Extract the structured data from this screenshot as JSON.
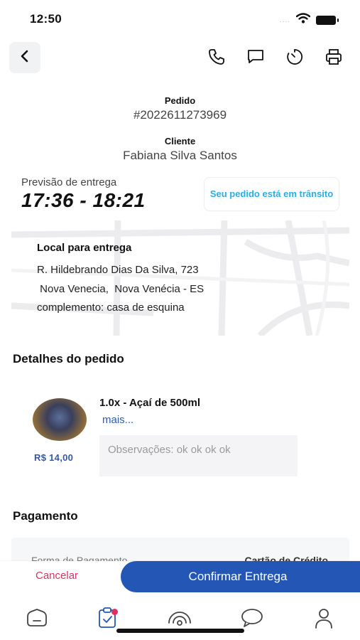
{
  "status_bar": {
    "time": "12:50",
    "signal": "....",
    "icons": [
      "wifi-icon",
      "battery-icon"
    ]
  },
  "header": {
    "back_icon": "chevron-left-icon",
    "actions": [
      "phone-icon",
      "chat-icon",
      "timer-icon",
      "printer-icon"
    ]
  },
  "order": {
    "label": "Pedido",
    "number": "#2022611273969"
  },
  "customer": {
    "label": "Cliente",
    "name": "Fabiana Silva Santos"
  },
  "forecast": {
    "label": "Previsão de entrega",
    "time": "17:36 - 18:21"
  },
  "status_badge": {
    "text": "Seu pedido está em trânsito",
    "color": "#29aee6"
  },
  "delivery": {
    "title": "Local para entrega",
    "street": "R. Hildebrando Dias Da Silva, 723",
    "city": " Nova Venecia,  Nova Venécia - ES",
    "complement": "complemento: casa de esquina"
  },
  "details": {
    "title": "Detalhes do pedido",
    "items": [
      {
        "name": "1.0x - Açaí de 500ml",
        "more": "mais...",
        "price": "R$ 14,00",
        "notes": "Observações: ok ok ok ok"
      }
    ]
  },
  "payment": {
    "title": "Pagamento",
    "method_label": "Forma de Pagamento",
    "method_value": "Cartão de Crédito"
  },
  "actions": {
    "cancel": "Cancelar",
    "confirm": "Confirmar Entrega"
  },
  "tab_bar": {
    "tabs": [
      "home-icon",
      "orders-icon",
      "broadcast-icon",
      "chat-icon",
      "profile-icon"
    ],
    "active": "orders-icon"
  },
  "colors": {
    "primary": "#2456b5",
    "cancel": "#e03060",
    "accent": "#29aee6",
    "price": "#2f58b5"
  }
}
